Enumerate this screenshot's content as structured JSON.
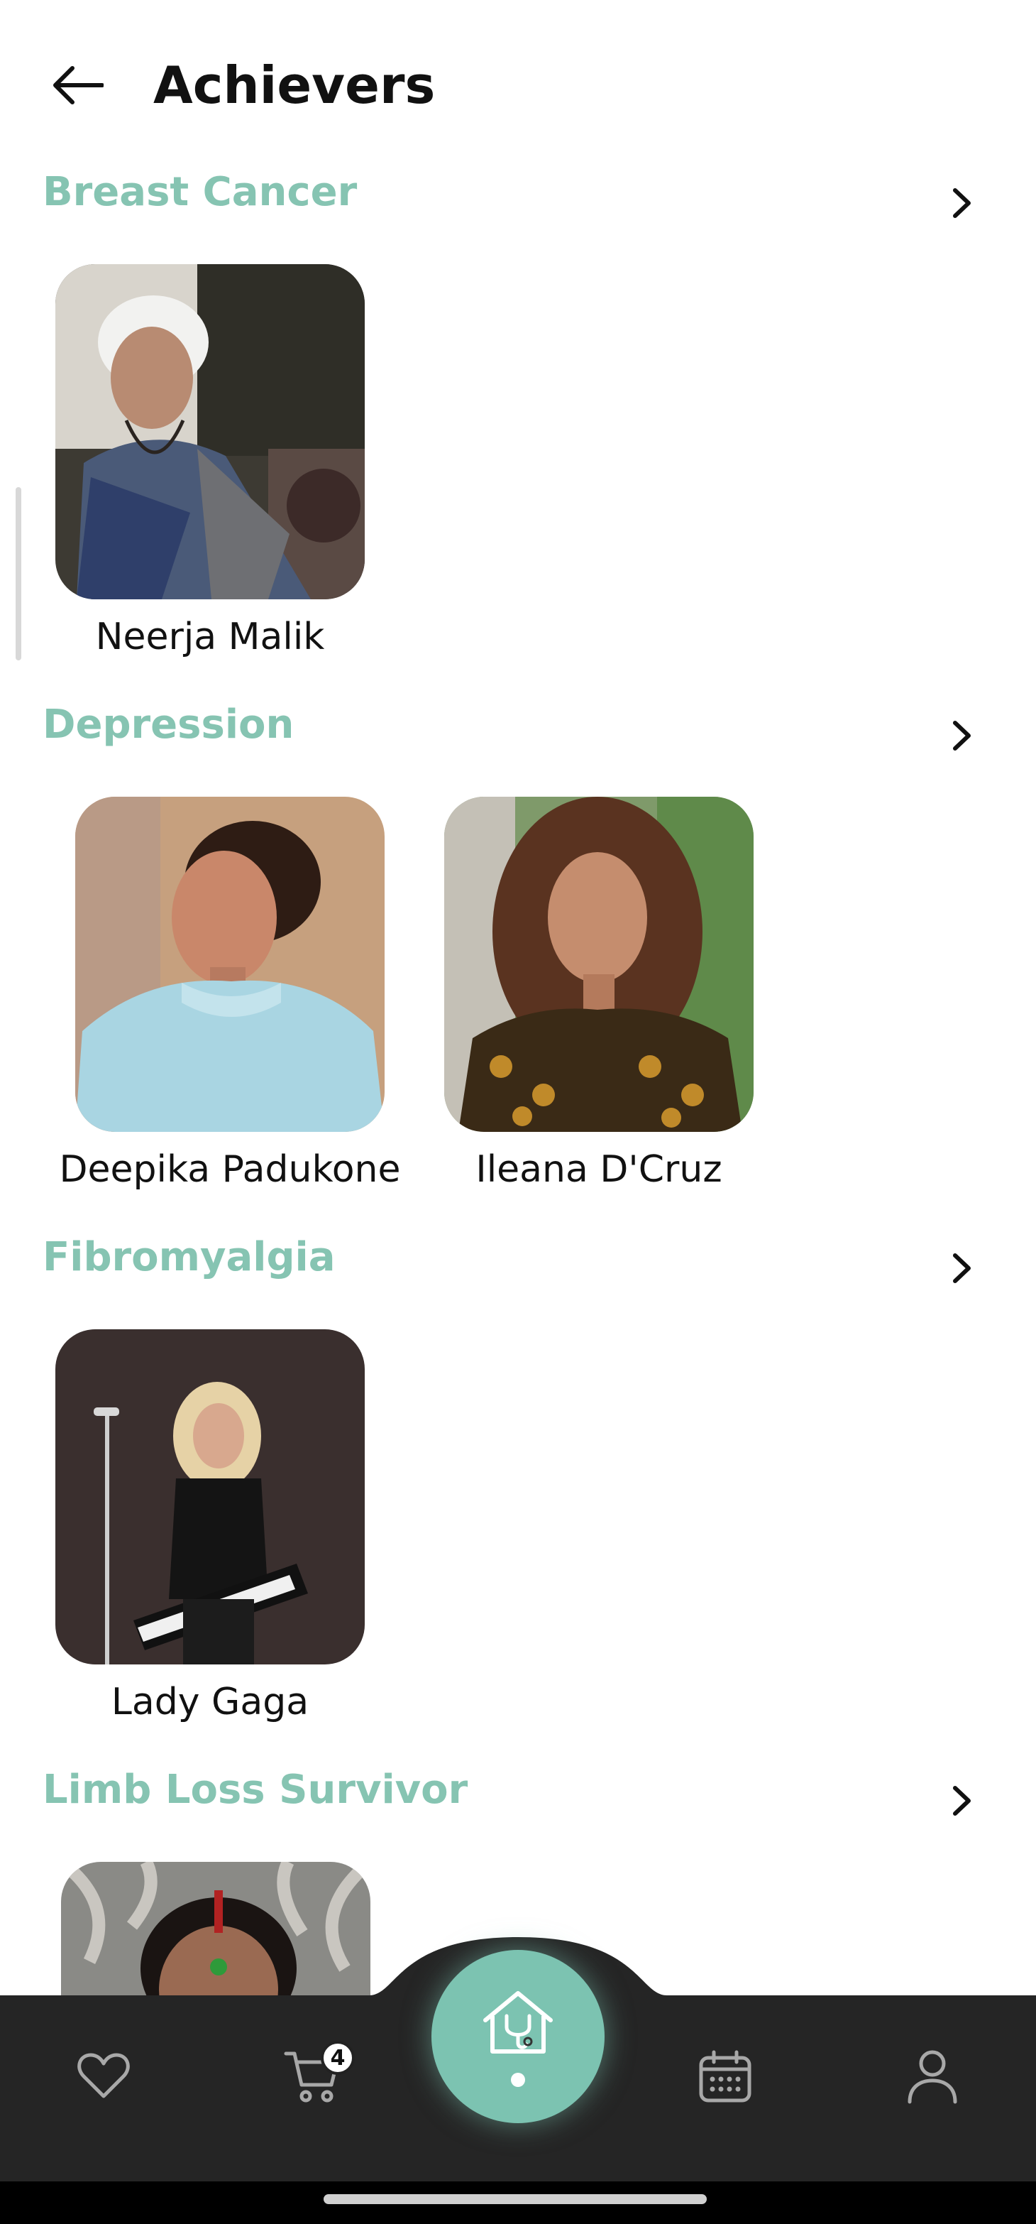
{
  "header": {
    "title": "Achievers"
  },
  "sections": [
    {
      "title": "Breast Cancer",
      "achievers": [
        {
          "name": "Neerja Malik"
        }
      ]
    },
    {
      "title": "Depression",
      "achievers": [
        {
          "name": "Deepika Padukone"
        },
        {
          "name": "Ileana D'Cruz"
        }
      ]
    },
    {
      "title": "Fibromyalgia",
      "achievers": [
        {
          "name": "Lady Gaga"
        }
      ]
    },
    {
      "title": "Limb Loss Survivor",
      "achievers": [
        {
          "name": ""
        }
      ]
    }
  ],
  "bottom_nav": {
    "items": [
      "heart-icon",
      "cart-icon",
      "home-doctor-icon",
      "calendar-icon",
      "profile-icon"
    ],
    "cart_count": "4"
  },
  "colors": {
    "accent": "#86c4b2",
    "fab": "#7cc3b1",
    "nav_background": "#252525"
  }
}
